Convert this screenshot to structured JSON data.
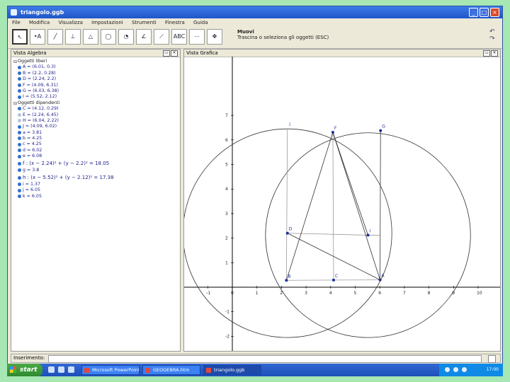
{
  "window": {
    "title": "triangolo.ggb",
    "controls": [
      "minimize",
      "maximize",
      "close"
    ]
  },
  "menu": [
    "File",
    "Modifica",
    "Visualizza",
    "Impostazioni",
    "Strumenti",
    "Finestra",
    "Guida"
  ],
  "toolbar": {
    "tools": [
      {
        "icon": "move-arrow-icon",
        "glyph": "↖",
        "selected": true
      },
      {
        "icon": "point-icon",
        "glyph": "•A",
        "selected": false
      },
      {
        "icon": "line-icon",
        "glyph": "╱",
        "selected": false
      },
      {
        "icon": "perpendicular-icon",
        "glyph": "⊥",
        "selected": false
      },
      {
        "icon": "polygon-icon",
        "glyph": "△",
        "selected": false
      },
      {
        "icon": "circle-icon",
        "glyph": "◯",
        "selected": false
      },
      {
        "icon": "arc-icon",
        "glyph": "◔",
        "selected": false
      },
      {
        "icon": "angle-icon",
        "glyph": "∠",
        "selected": false
      },
      {
        "icon": "reflect-icon",
        "glyph": "⟋",
        "selected": false
      },
      {
        "icon": "text-icon",
        "glyph": "ABC",
        "selected": false
      },
      {
        "icon": "slider-icon",
        "glyph": "⋯",
        "selected": false
      },
      {
        "icon": "move-view-icon",
        "glyph": "✥",
        "selected": false
      }
    ],
    "hint_title": "Muovi",
    "hint_text": "Trascina o seleziona gli oggetti (ESC)"
  },
  "algebra": {
    "header": "Vista Algebra",
    "rows": [
      {
        "kind": "group",
        "text": "Oggetti liberi"
      },
      {
        "kind": "item",
        "text": "A = (6.01, 0.3)",
        "visible": true
      },
      {
        "kind": "item",
        "text": "B = (2.2, 0.28)",
        "visible": true
      },
      {
        "kind": "item",
        "text": "D = (2.24, 2.2)",
        "visible": true
      },
      {
        "kind": "item",
        "text": "F = (4.09, 6.31)",
        "visible": true
      },
      {
        "kind": "item",
        "text": "G = (6.03, 6.38)",
        "visible": true
      },
      {
        "kind": "item",
        "text": "I = (5.52, 2.12)",
        "visible": true
      },
      {
        "kind": "group",
        "text": "Oggetti dipendenti"
      },
      {
        "kind": "item",
        "text": "C = (4.12, 0.29)",
        "visible": true
      },
      {
        "kind": "item",
        "text": "E = (2.24, 6.45)",
        "visible": false
      },
      {
        "kind": "item",
        "text": "H = (6.04, 2.22)",
        "visible": false
      },
      {
        "kind": "item",
        "text": "J = (4.09, 6.02)",
        "visible": true
      },
      {
        "kind": "item",
        "text": "a = 3.81",
        "visible": true
      },
      {
        "kind": "item",
        "text": "b = 4.25",
        "visible": true
      },
      {
        "kind": "item",
        "text": "c = 4.25",
        "visible": true
      },
      {
        "kind": "item",
        "text": "d = 6.02",
        "visible": true
      },
      {
        "kind": "item",
        "text": "e = 6.08",
        "visible": true
      },
      {
        "kind": "item",
        "text": "f : (x − 2.24)² + (y − 2.2)² = 18.05",
        "visible": true,
        "big": true
      },
      {
        "kind": "item",
        "text": "g = 3.8",
        "visible": true
      },
      {
        "kind": "item",
        "text": "h : (x − 5.52)² + (y − 2.12)² = 17.38",
        "visible": true,
        "big": true
      },
      {
        "kind": "item",
        "text": "i = 1.37",
        "visible": true
      },
      {
        "kind": "item",
        "text": "j = 6.05",
        "visible": true
      },
      {
        "kind": "item",
        "text": "k = 6.05",
        "visible": true
      }
    ]
  },
  "graphics": {
    "header": "Vista Grafica",
    "x_ticks": [
      "-1",
      "0",
      "1",
      "2",
      "3",
      "4",
      "5",
      "6",
      "7",
      "8",
      "9",
      "10"
    ],
    "y_ticks": [
      "7",
      "6",
      "5",
      "4",
      "3",
      "2",
      "1",
      "-1",
      "-2"
    ],
    "points": [
      {
        "name": "E",
        "x": 2.24,
        "y": 6.45,
        "shown": false
      },
      {
        "name": "F",
        "x": 4.09,
        "y": 6.31,
        "shown": true
      },
      {
        "name": "G",
        "x": 6.03,
        "y": 6.38,
        "shown": true
      },
      {
        "name": "D",
        "x": 2.24,
        "y": 2.2,
        "shown": true
      },
      {
        "name": "I",
        "x": 5.52,
        "y": 2.12,
        "shown": true
      },
      {
        "name": "B",
        "x": 2.2,
        "y": 0.28,
        "shown": true
      },
      {
        "name": "C",
        "x": 4.12,
        "y": 0.29,
        "shown": true
      },
      {
        "name": "A",
        "x": 6.01,
        "y": 0.3,
        "shown": true
      }
    ],
    "circles": [
      {
        "name": "f",
        "cx": 2.24,
        "cy": 2.2,
        "r": 4.25
      },
      {
        "name": "h",
        "cx": 5.52,
        "cy": 2.12,
        "r": 4.17
      }
    ]
  },
  "input_bar": {
    "label": "Inserimento:"
  },
  "taskbar": {
    "start_label": "start",
    "items": [
      {
        "label": "Microsoft PowerPoint - ...",
        "active": false
      },
      {
        "label": "GEOGEBRA.htm",
        "active": false
      },
      {
        "label": "triangolo.ggb",
        "active": true
      }
    ],
    "clock": "17:00"
  }
}
